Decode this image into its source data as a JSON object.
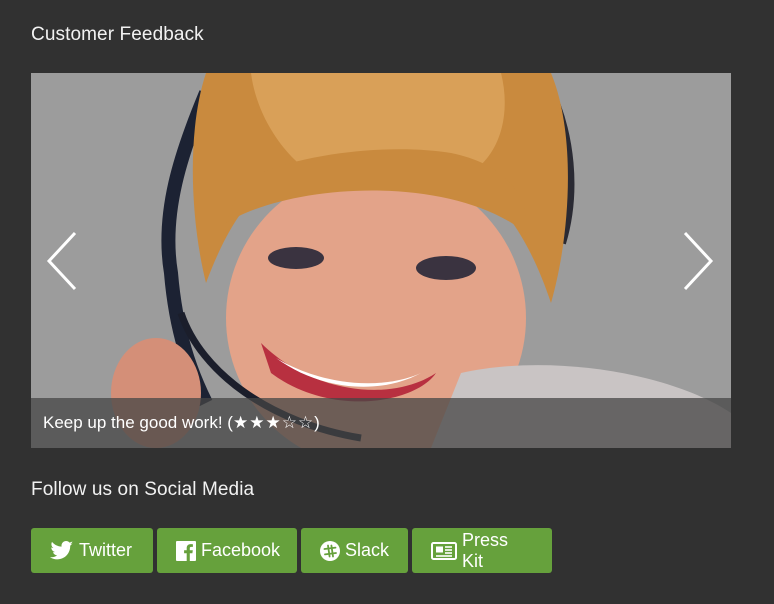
{
  "feedback": {
    "title": "Customer Feedback",
    "caption_text": "Keep up the good work! (",
    "caption_stars": "★★★☆☆",
    "caption_close": ")",
    "rating": 3,
    "rating_max": 5,
    "prev_icon": "chevron-left-icon",
    "next_icon": "chevron-right-icon"
  },
  "social": {
    "title": "Follow us on Social Media",
    "buttons": [
      {
        "label": "Twitter",
        "icon": "twitter-icon"
      },
      {
        "label": "Facebook",
        "icon": "facebook-icon"
      },
      {
        "label": "Slack",
        "icon": "slack-icon"
      },
      {
        "label": "Press Kit",
        "icon": "newspaper-icon"
      }
    ],
    "button_color": "#66a13c"
  },
  "colors": {
    "background": "#313131",
    "caption_overlay": "#464646"
  }
}
